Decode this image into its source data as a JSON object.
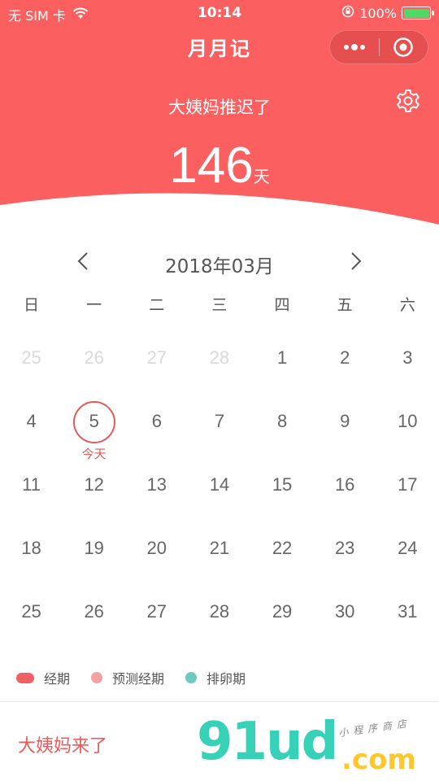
{
  "status_bar": {
    "carrier": "无 SIM 卡",
    "time": "10:14",
    "battery": "100%"
  },
  "navbar": {
    "title": "月月记"
  },
  "header": {
    "status_text": "大姨妈推迟了",
    "days_count": "146",
    "days_unit": "天"
  },
  "calendar": {
    "month_label": "2018年03月",
    "weekdays": [
      "日",
      "一",
      "二",
      "三",
      "四",
      "五",
      "六"
    ],
    "today_label": "今天",
    "weeks": [
      [
        "25",
        "26",
        "27",
        "28",
        "1",
        "2",
        "3"
      ],
      [
        "4",
        "5",
        "6",
        "7",
        "8",
        "9",
        "10"
      ],
      [
        "11",
        "12",
        "13",
        "14",
        "15",
        "16",
        "17"
      ],
      [
        "18",
        "19",
        "20",
        "21",
        "22",
        "23",
        "24"
      ],
      [
        "25",
        "26",
        "27",
        "28",
        "29",
        "30",
        "31"
      ]
    ]
  },
  "legend": {
    "items": [
      {
        "label": "经期",
        "color": "#f06065"
      },
      {
        "label": "预测经期",
        "color": "#f6a1a3"
      },
      {
        "label": "排卵期",
        "color": "#6dcabf"
      }
    ]
  },
  "bottom": {
    "action_label": "大姨妈来了"
  },
  "watermark": {
    "logo": "91ud",
    "suffix": ".com",
    "tag": "小程序商店"
  },
  "colors": {
    "header_bg": "#fc5f5f",
    "accent": "#e15b5b"
  }
}
